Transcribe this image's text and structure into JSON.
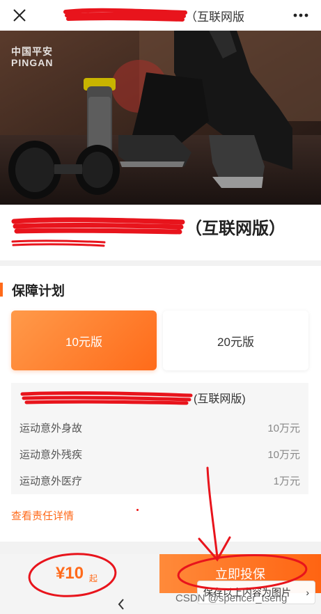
{
  "nav": {
    "title_suffix": "（互联网版",
    "close_icon": "close-icon",
    "more_icon": "more-dots-icon"
  },
  "banner": {
    "logo_line1": "中国平安",
    "logo_line2": "PINGAN"
  },
  "product": {
    "title_suffix": "（互联网版）"
  },
  "plan": {
    "section_title": "保障计划",
    "tabs": [
      {
        "label": "10元版",
        "active": true
      },
      {
        "label": "20元版",
        "active": false
      }
    ],
    "coverage_name_suffix": "(互联网版)",
    "coverage": [
      {
        "label": "运动意外身故",
        "value": "10万元"
      },
      {
        "label": "运动意外残疾",
        "value": "10万元"
      },
      {
        "label": "运动意外医疗",
        "value": "1万元"
      }
    ],
    "details_link": "查看责任详情"
  },
  "footer": {
    "price": "¥10",
    "price_suffix": "起",
    "buy_label": "立即投保",
    "save_tip": "保存以上内容为图片",
    "save_tip_arrow": "›",
    "back_icon": "chevron-left-icon"
  },
  "watermark": "CSDN @spencer_tseng",
  "colors": {
    "accent": "#ff6a1a",
    "annotation_red": "#e8141c"
  }
}
